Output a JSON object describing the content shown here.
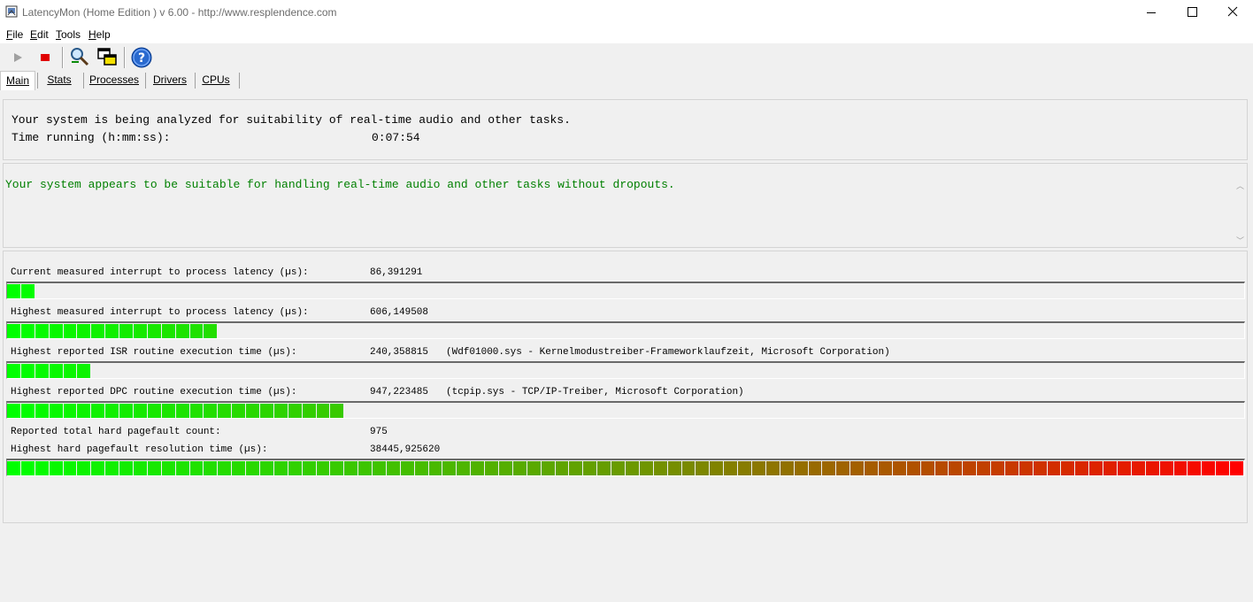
{
  "window": {
    "title": "LatencyMon  (Home Edition )  v 6.00 - http://www.resplendence.com",
    "controls": [
      "minimize",
      "maximize",
      "close"
    ]
  },
  "menu": [
    {
      "label": "File",
      "underline": "F",
      "rest": "ile"
    },
    {
      "label": "Edit",
      "underline": "E",
      "rest": "dit"
    },
    {
      "label": "Tools",
      "underline": "T",
      "rest": "ools"
    },
    {
      "label": "Help",
      "underline": "H",
      "rest": "elp"
    }
  ],
  "toolbar": {
    "buttons": [
      {
        "name": "start-button",
        "icon": "play-icon",
        "enabled": false
      },
      {
        "name": "stop-button",
        "icon": "stop-icon",
        "enabled": true
      },
      {
        "name": "analyze-tool-button",
        "icon": "magnifier-icon",
        "enabled": true
      },
      {
        "name": "windows-button",
        "icon": "windows-icon",
        "enabled": true
      },
      {
        "name": "help-button",
        "icon": "help-icon",
        "enabled": true
      }
    ]
  },
  "tabs": [
    {
      "label": "Main",
      "active": true
    },
    {
      "label": "Stats",
      "active": false
    },
    {
      "label": "Processes",
      "active": false
    },
    {
      "label": "Drivers",
      "active": false
    },
    {
      "label": "CPUs",
      "active": false
    }
  ],
  "status": {
    "line1": "Your system is being analyzed for suitability of real-time audio and other tasks.",
    "time_label": "Time running (h:mm:ss):",
    "time_value": "0:07:54"
  },
  "verdict": {
    "text": "Your system appears to be suitable for handling real-time audio and other tasks without dropouts.",
    "color": "#008000"
  },
  "metrics": {
    "current_latency": {
      "label": "Current measured interrupt to process latency (µs):",
      "value": "86,391291",
      "detail": "",
      "segments_filled": 2
    },
    "highest_latency": {
      "label": "Highest measured interrupt to process latency (µs):",
      "value": "606,149508",
      "detail": "",
      "segments_filled": 15
    },
    "isr": {
      "label": "Highest reported ISR routine execution time (µs):",
      "value": "240,358815",
      "detail": "(Wdf01000.sys - Kernelmodustreiber-Frameworklaufzeit, Microsoft Corporation)",
      "segments_filled": 6
    },
    "dpc": {
      "label": "Highest reported DPC routine execution time (µs):",
      "value": "947,223485",
      "detail": "(tcpip.sys - TCP/IP-Treiber, Microsoft Corporation)",
      "segments_filled": 24
    },
    "pagefault_count": {
      "label": "Reported total hard pagefault count:",
      "value": "975"
    },
    "pagefault_time": {
      "label": "Highest hard pagefault resolution time (µs):",
      "value": "38445,925620",
      "segments_filled": 88
    }
  },
  "bar_scale": {
    "total_segments": 88,
    "colors": {
      "low": "#00ff00",
      "mid": "#6a9a00",
      "high": "#ff0000"
    }
  }
}
